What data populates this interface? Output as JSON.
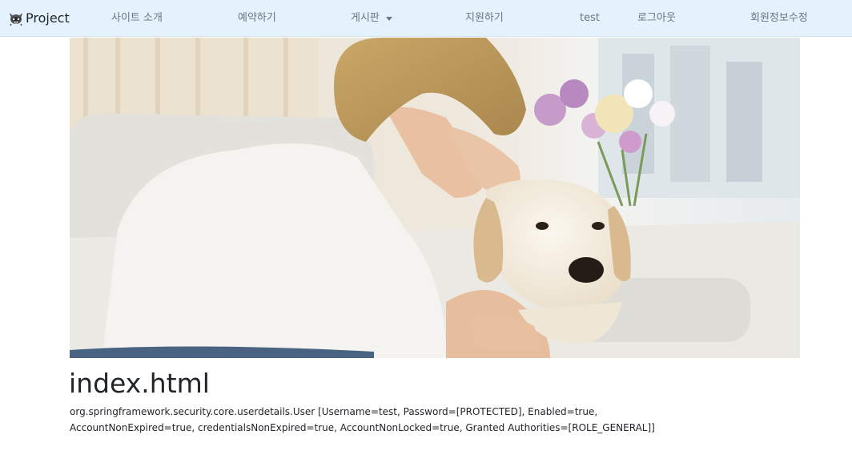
{
  "navbar": {
    "brand": "Project",
    "items": [
      {
        "label": "사이트 소개"
      },
      {
        "label": "예약하기"
      },
      {
        "label": "게시판"
      },
      {
        "label": "지원하기"
      },
      {
        "label": "test"
      },
      {
        "label": "로그아웃"
      },
      {
        "label": "회원정보수정"
      }
    ],
    "dropdown_icon": "caret-down-icon",
    "brand_icon": "raccoon-logo-icon"
  },
  "hero": {
    "image": "woman-kissing-dog-photo"
  },
  "main": {
    "title": "index.html",
    "user_info": "org.springframework.security.core.userdetails.User [Username=test, Password=[PROTECTED], Enabled=true, AccountNonExpired=true, credentialsNonExpired=true, AccountNonLocked=true, Granted Authorities=[ROLE_GENERAL]]"
  },
  "colors": {
    "navbar_bg": "#e3f2fd",
    "nav_text": "#6c757d",
    "body_text": "#212529"
  }
}
